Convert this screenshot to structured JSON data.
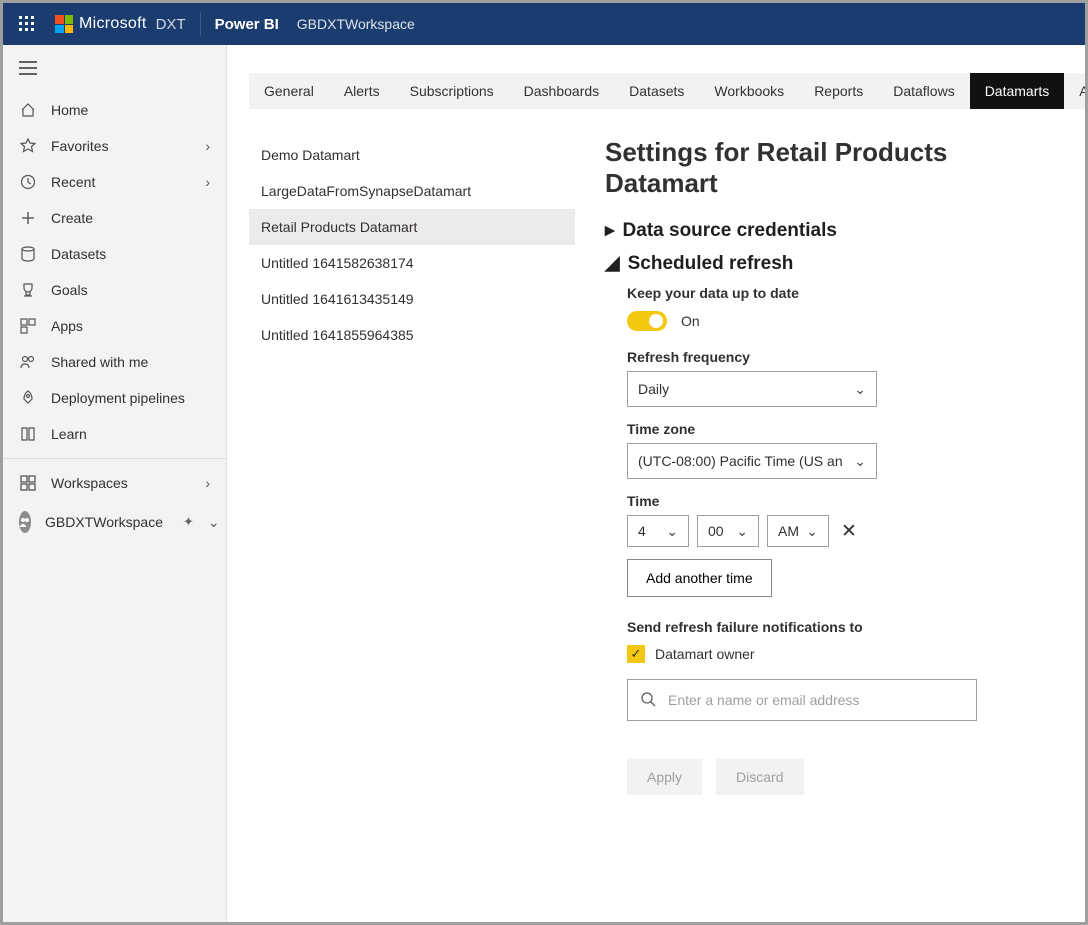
{
  "topbar": {
    "ms_label": "Microsoft",
    "dxt_label": "DXT",
    "product": "Power BI",
    "workspace": "GBDXTWorkspace"
  },
  "sidebar": {
    "items": [
      {
        "label": "Home",
        "icon": "home"
      },
      {
        "label": "Favorites",
        "icon": "star",
        "chev": true
      },
      {
        "label": "Recent",
        "icon": "clock",
        "chev": true
      },
      {
        "label": "Create",
        "icon": "plus"
      },
      {
        "label": "Datasets",
        "icon": "db"
      },
      {
        "label": "Goals",
        "icon": "trophy"
      },
      {
        "label": "Apps",
        "icon": "apps"
      },
      {
        "label": "Shared with me",
        "icon": "people"
      },
      {
        "label": "Deployment pipelines",
        "icon": "rocket"
      },
      {
        "label": "Learn",
        "icon": "book"
      }
    ],
    "workspaces_label": "Workspaces",
    "current_ws": "GBDXTWorkspace"
  },
  "tabs": [
    "General",
    "Alerts",
    "Subscriptions",
    "Dashboards",
    "Datasets",
    "Workbooks",
    "Reports",
    "Dataflows",
    "Datamarts",
    "App"
  ],
  "active_tab": "Datamarts",
  "datamarts": [
    "Demo Datamart",
    "LargeDataFromSynapseDatamart",
    "Retail Products Datamart",
    "Untitled 1641582638174",
    "Untitled 1641613435149",
    "Untitled 1641855964385"
  ],
  "selected_datamart": "Retail Products Datamart",
  "panel": {
    "title": "Settings for Retail Products Datamart",
    "section_credentials": "Data source credentials",
    "section_refresh": "Scheduled refresh",
    "keep_label": "Keep your data up to date",
    "toggle_state": "On",
    "freq_label": "Refresh frequency",
    "freq_value": "Daily",
    "tz_label": "Time zone",
    "tz_value": "(UTC-08:00) Pacific Time (US an",
    "time_label": "Time",
    "time_hour": "4",
    "time_min": "00",
    "time_ampm": "AM",
    "add_time": "Add another time",
    "notify_label": "Send refresh failure notifications to",
    "notify_owner": "Datamart owner",
    "search_placeholder": "Enter a name or email address",
    "apply": "Apply",
    "discard": "Discard"
  }
}
